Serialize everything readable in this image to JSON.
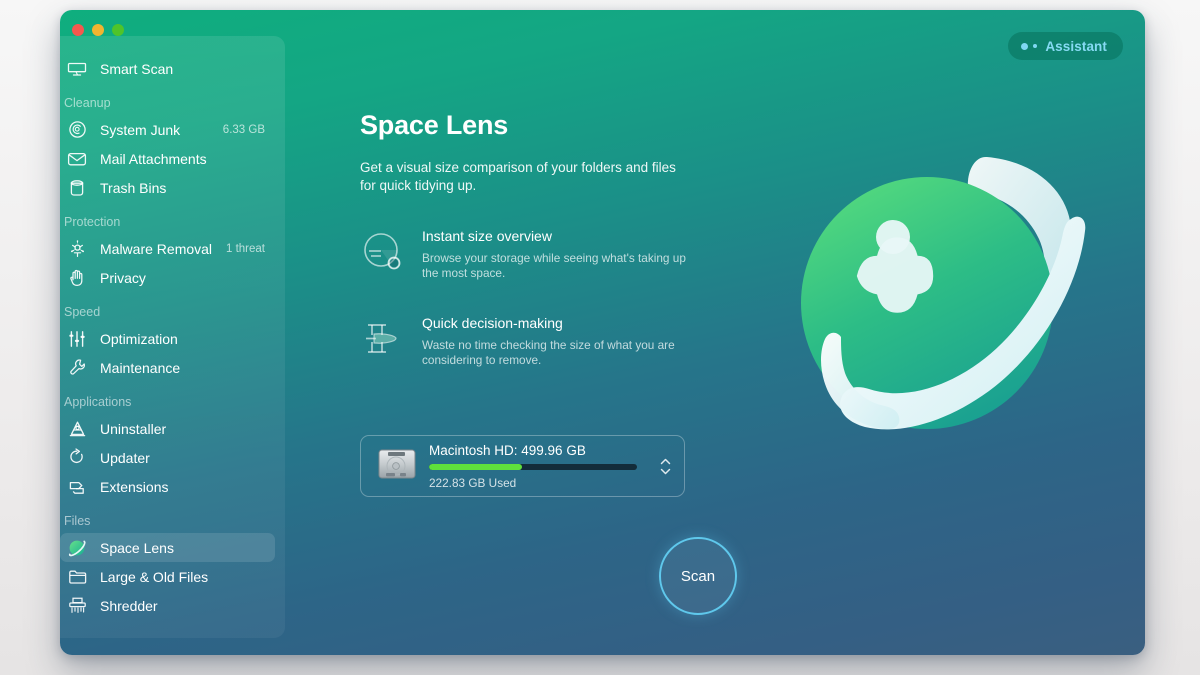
{
  "window": {
    "traffic_lights": [
      "close",
      "minimize",
      "zoom"
    ]
  },
  "assistant": {
    "label": "Assistant"
  },
  "sidebar": {
    "groups": [
      {
        "label": "",
        "items": [
          {
            "label": "Smart Scan",
            "icon": "display-icon",
            "meta": "",
            "active": false
          }
        ]
      },
      {
        "label": "Cleanup",
        "items": [
          {
            "label": "System Junk",
            "icon": "junk-icon",
            "meta": "6.33 GB",
            "active": false
          },
          {
            "label": "Mail Attachments",
            "icon": "mail-icon",
            "meta": "",
            "active": false
          },
          {
            "label": "Trash Bins",
            "icon": "trash-icon",
            "meta": "",
            "active": false
          }
        ]
      },
      {
        "label": "Protection",
        "items": [
          {
            "label": "Malware Removal",
            "icon": "biohazard-icon",
            "meta": "1 threat",
            "active": false
          },
          {
            "label": "Privacy",
            "icon": "hand-icon",
            "meta": "",
            "active": false
          }
        ]
      },
      {
        "label": "Speed",
        "items": [
          {
            "label": "Optimization",
            "icon": "sliders-icon",
            "meta": "",
            "active": false
          },
          {
            "label": "Maintenance",
            "icon": "wrench-icon",
            "meta": "",
            "active": false
          }
        ]
      },
      {
        "label": "Applications",
        "items": [
          {
            "label": "Uninstaller",
            "icon": "uninstaller-icon",
            "meta": "",
            "active": false
          },
          {
            "label": "Updater",
            "icon": "updater-icon",
            "meta": "",
            "active": false
          },
          {
            "label": "Extensions",
            "icon": "extensions-icon",
            "meta": "",
            "active": false
          }
        ]
      },
      {
        "label": "Files",
        "items": [
          {
            "label": "Space Lens",
            "icon": "planet-icon",
            "meta": "",
            "active": true
          },
          {
            "label": "Large & Old Files",
            "icon": "folder-icon",
            "meta": "",
            "active": false
          },
          {
            "label": "Shredder",
            "icon": "shredder-icon",
            "meta": "",
            "active": false
          }
        ]
      }
    ]
  },
  "main": {
    "title": "Space Lens",
    "subtitle": "Get a visual size comparison of your folders and files for quick tidying up.",
    "features": [
      {
        "icon": "pie-magnifier-icon",
        "title": "Instant size overview",
        "desc": "Browse your storage while seeing what's taking up the most space."
      },
      {
        "icon": "scale-icon",
        "title": "Quick decision-making",
        "desc": "Waste no time checking the size of what you are considering to remove."
      }
    ]
  },
  "disk": {
    "icon": "hard-drive-icon",
    "name": "Macintosh HD: 499.96 GB",
    "used_label": "222.83 GB Used",
    "used_percent": 44.6,
    "fill_color": "#5fe03c",
    "track_color": "#132c3a",
    "stepper": "up-down-stepper"
  },
  "scan": {
    "label": "Scan",
    "ring_color": "#5fc8ec"
  },
  "illustration": {
    "name": "space-lens-planet-illustration",
    "planet_color": "#2ec07a",
    "ring_color": "#dff3f5"
  }
}
